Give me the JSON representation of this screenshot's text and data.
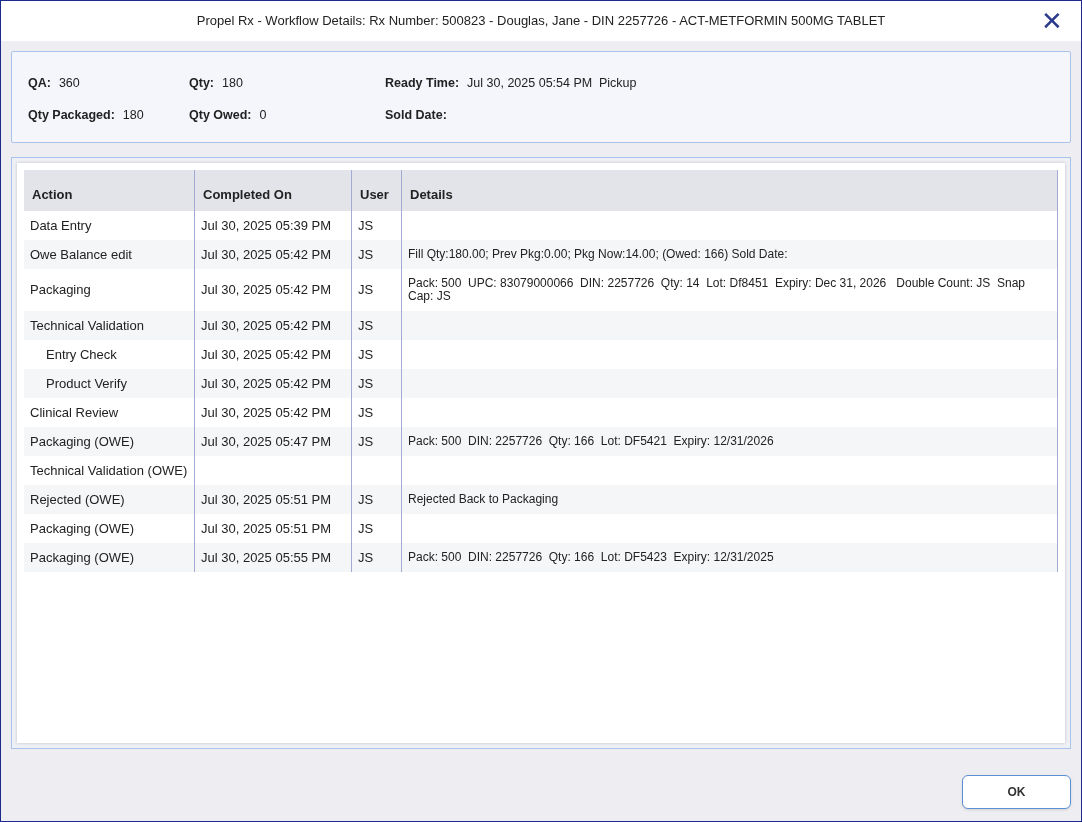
{
  "window": {
    "title": "Propel Rx - Workflow Details: Rx Number: 500823 - Douglas, Jane - DIN 2257726 - ACT-METFORMIN 500MG TABLET",
    "close": "✕"
  },
  "summary": [
    [
      {
        "label": "QA:",
        "value": "360"
      },
      {
        "label": "Qty:",
        "value": "180"
      },
      {
        "label": "Ready Time:",
        "value": "Jul 30, 2025 05:54 PM"
      },
      {
        "value": "Pickup"
      }
    ],
    [
      {
        "label": "Qty Packaged:",
        "value": "180"
      },
      {
        "label": "Qty Owed:",
        "value": "0"
      },
      {
        "label": "Sold Date:"
      }
    ]
  ],
  "table": {
    "columns": [
      "Action",
      "Completed On",
      "User",
      "Details"
    ],
    "rows": [
      {
        "action": "Data Entry",
        "completed_on": "Jul 30, 2025 05:39 PM",
        "user": "JS"
      },
      {
        "action": "Owe Balance edit",
        "completed_on": "Jul 30, 2025 05:42 PM",
        "user": "JS",
        "details": "Fill Qty:180.00; Prev Pkg:0.00; Pkg Now:14.00; (Owed: 166) Sold Date:"
      },
      {
        "action": "Packaging",
        "completed_on": "Jul 30, 2025 05:42 PM",
        "user": "JS",
        "details": "Pack: 500  UPC: 83079000066  DIN: 2257726  Qty: 14  Lot: Df8451  Expiry: Dec 31, 2026   Double Count: JS  Snap Cap: JS"
      },
      {
        "action": "Technical Validation",
        "completed_on": "Jul 30, 2025 05:42 PM",
        "user": "JS",
        "children": [
          {
            "action": "Entry Check",
            "completed_on": "Jul 30, 2025 05:42 PM",
            "user": "JS"
          },
          {
            "action": "Product Verify",
            "completed_on": "Jul 30, 2025 05:42 PM",
            "user": "JS"
          }
        ]
      },
      {
        "action": "Clinical Review",
        "completed_on": "Jul 30, 2025 05:42 PM",
        "user": "JS"
      },
      {
        "action": "Packaging (OWE)",
        "completed_on": "Jul 30, 2025 05:47 PM",
        "user": "JS",
        "details": "Pack: 500  DIN: 2257726  Qty: 166  Lot: DF5421  Expiry: 12/31/2026"
      },
      {
        "action": "Technical Validation (OWE)"
      },
      {
        "action": "Rejected (OWE)",
        "completed_on": "Jul 30, 2025 05:51 PM",
        "user": "JS",
        "details": "Rejected Back to Packaging"
      },
      {
        "action": "Packaging (OWE)",
        "completed_on": "Jul 30, 2025 05:51 PM",
        "user": "JS"
      },
      {
        "action": "Packaging (OWE)",
        "completed_on": "Jul 30, 2025 05:55 PM",
        "user": "JS",
        "details": "Pack: 500  DIN: 2257726  Qty: 166  Lot: DF5423  Expiry: 12/31/2025"
      }
    ]
  },
  "buttons": [
    "OK"
  ]
}
